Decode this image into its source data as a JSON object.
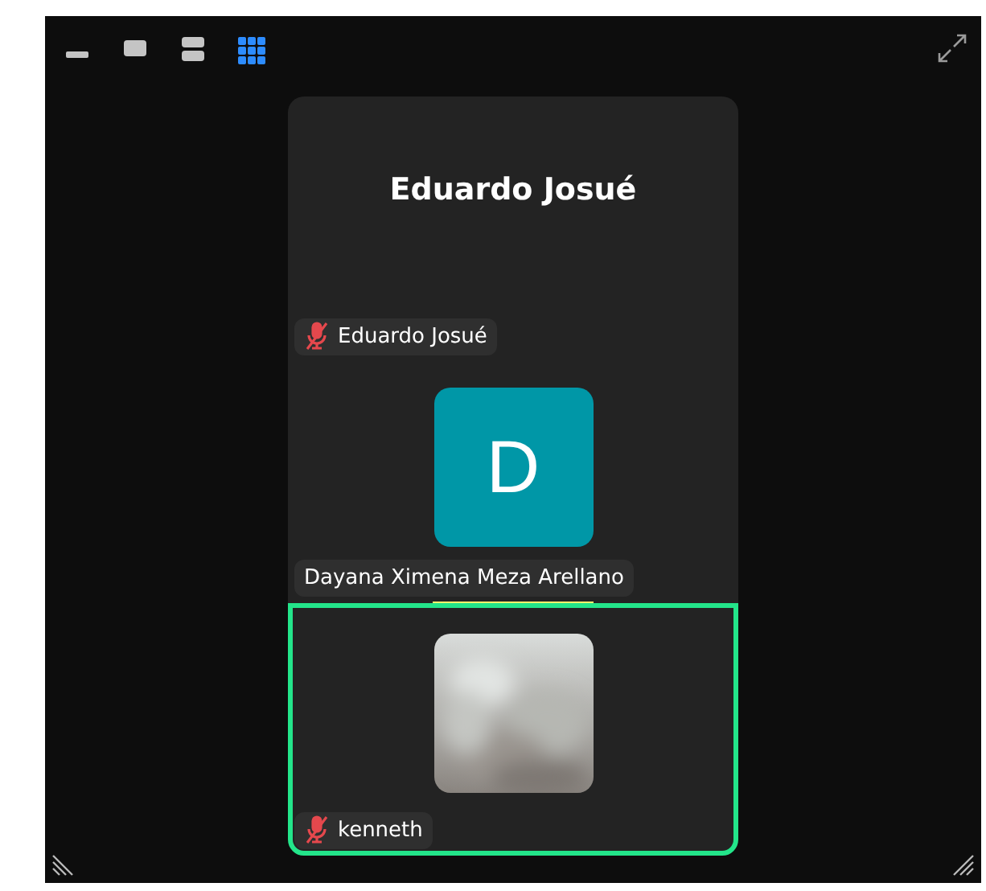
{
  "view_modes": [
    {
      "kind": "minimize",
      "selected": false
    },
    {
      "kind": "single",
      "selected": false
    },
    {
      "kind": "split",
      "selected": false
    },
    {
      "kind": "gallery",
      "selected": true
    }
  ],
  "participants": [
    {
      "kind": "name",
      "display": "Eduardo Josué",
      "label": "Eduardo Josué",
      "muted": true,
      "speaking": false,
      "active": false
    },
    {
      "kind": "avatar",
      "display": "D",
      "color": "#0097a7",
      "label": "Dayana Ximena Meza Arellano",
      "muted": false,
      "speaking": true,
      "active": false
    },
    {
      "kind": "video",
      "label": "kenneth",
      "muted": true,
      "speaking": false,
      "active": true
    }
  ]
}
